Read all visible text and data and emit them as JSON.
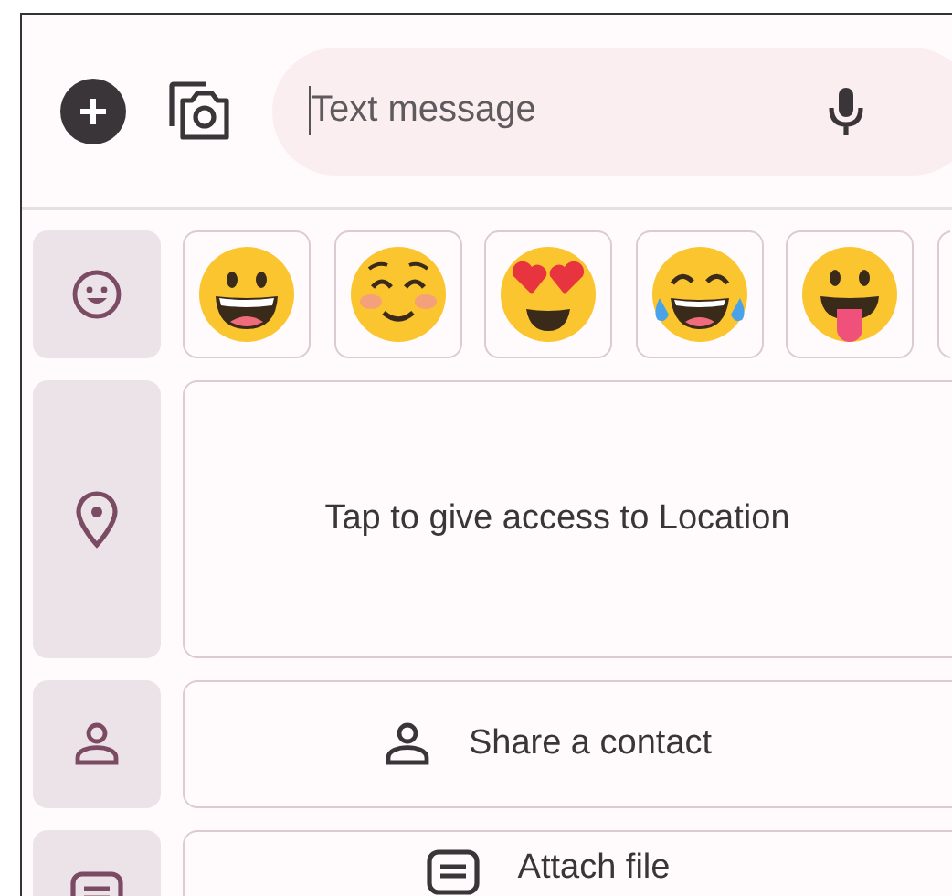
{
  "compose_bar": {
    "message_field": {
      "placeholder": "Text message"
    }
  },
  "emoji_row": {
    "emojis": [
      {
        "kind": "grin"
      },
      {
        "kind": "blush"
      },
      {
        "kind": "heart-eyes"
      },
      {
        "kind": "tears-of-joy"
      },
      {
        "kind": "tongue"
      },
      {
        "kind": "cut"
      }
    ]
  },
  "panels": [
    {
      "kind": "location",
      "label": "Tap to give access to Location"
    },
    {
      "kind": "contact",
      "label": "Share a contact"
    },
    {
      "kind": "file",
      "label": "Attach file"
    }
  ]
}
